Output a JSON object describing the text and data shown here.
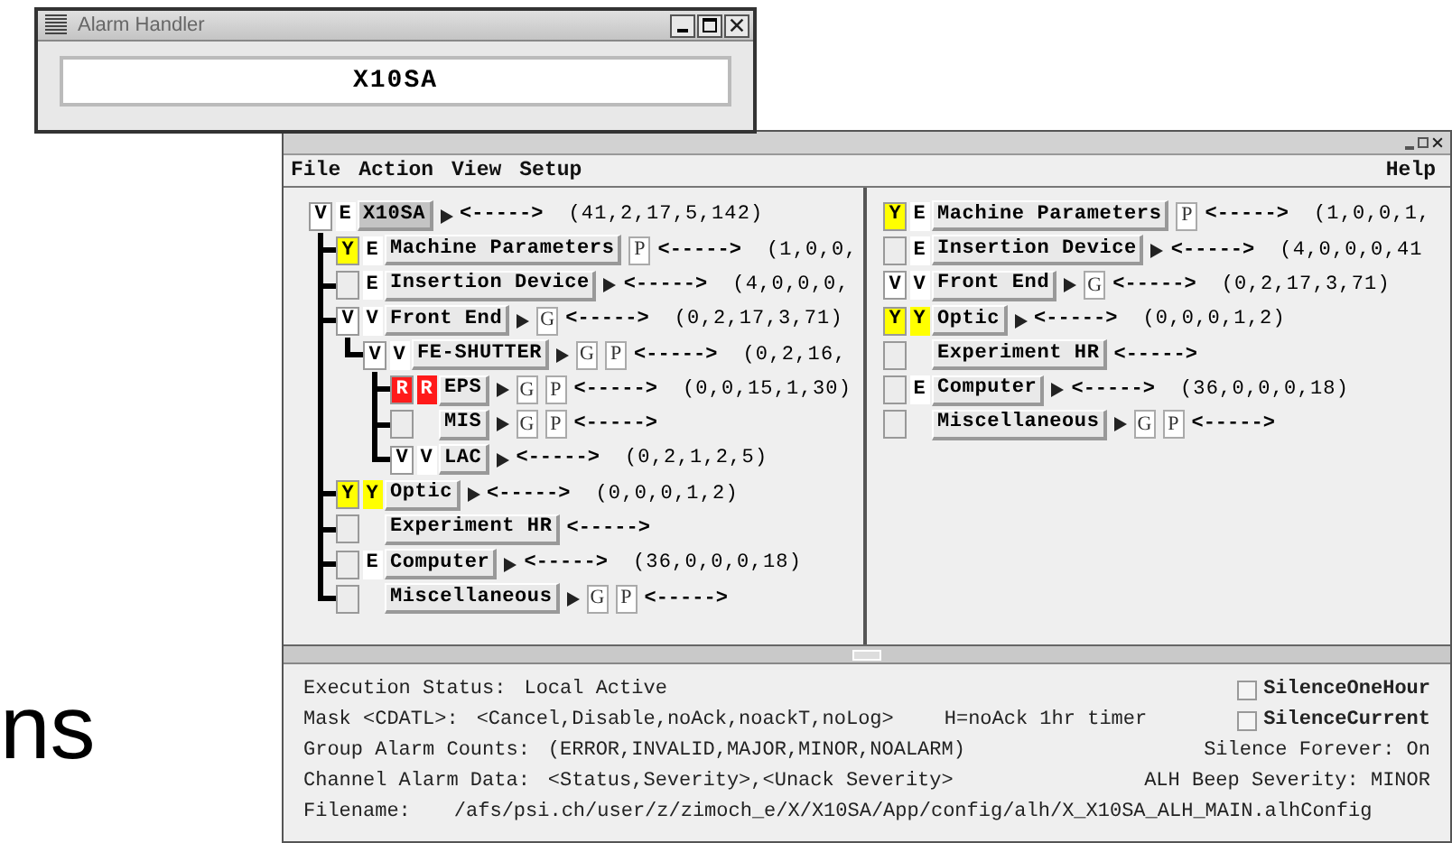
{
  "background_text": "ns",
  "popup_window": {
    "title": "Alarm Handler",
    "group": "X10SA"
  },
  "main_window": {
    "menus": [
      "File",
      "Action",
      "View",
      "Setup"
    ],
    "help_menu": "Help",
    "tree": [
      {
        "ack": {
          "text": "V",
          "color": "#ffffff"
        },
        "unack": {
          "text": "E",
          "color": "#ffffff"
        },
        "name": "X10SA",
        "selected": true,
        "has_arrow": true,
        "link": "<----->",
        "counts": "(41,2,17,5,142)",
        "children": [
          {
            "ack": {
              "text": "Y",
              "color": "#ffff00"
            },
            "unack": {
              "text": "E",
              "color": "#ffffff"
            },
            "name": "Machine Parameters",
            "selected": false,
            "has_arrow": false,
            "buttons": [
              "P"
            ],
            "link": "<----->",
            "counts": "(1,0,0,"
          },
          {
            "ack": {
              "color": "#ececec"
            },
            "unack": {
              "text": "E",
              "color": "#ffffff"
            },
            "name": "Insertion Device",
            "selected": false,
            "has_arrow": true,
            "link": "<----->",
            "counts": "(4,0,0,0,"
          },
          {
            "ack": {
              "text": "V",
              "color": "#ffffff"
            },
            "unack": {
              "text": "V",
              "color": "#ffffff"
            },
            "name": "Front End",
            "selected": false,
            "has_arrow": true,
            "buttons": [
              "G"
            ],
            "link": "<----->",
            "counts": "(0,2,17,3,71)",
            "children": [
              {
                "ack": {
                  "text": "V",
                  "color": "#ffffff"
                },
                "unack": {
                  "text": "V",
                  "color": "#ffffff"
                },
                "name": "FE-SHUTTER",
                "selected": false,
                "has_arrow": true,
                "buttons": [
                  "G",
                  "P"
                ],
                "link": "<----->",
                "counts": "(0,2,16,",
                "children": [
                  {
                    "ack": {
                      "text": "R",
                      "color": "#ff1a1a"
                    },
                    "unack": {
                      "text": "R",
                      "color": "#ff1a1a"
                    },
                    "name": "EPS",
                    "selected": false,
                    "has_arrow": true,
                    "buttons": [
                      "G",
                      "P"
                    ],
                    "link": "<----->",
                    "counts": "(0,0,15,1,30)"
                  },
                  {
                    "ack": {
                      "color": "#ececec"
                    },
                    "name": "MIS",
                    "selected": false,
                    "has_arrow": true,
                    "buttons": [
                      "G",
                      "P"
                    ],
                    "link": "<----->"
                  },
                  {
                    "ack": {
                      "text": "V",
                      "color": "#ffffff"
                    },
                    "unack": {
                      "text": "V",
                      "color": "#ffffff"
                    },
                    "name": "LAC",
                    "selected": false,
                    "has_arrow": true,
                    "link": "<----->",
                    "counts": "(0,2,1,2,5)"
                  }
                ]
              }
            ]
          },
          {
            "ack": {
              "text": "Y",
              "color": "#ffff00"
            },
            "unack": {
              "text": "Y",
              "color": "#ffff00"
            },
            "name": "Optic",
            "selected": false,
            "has_arrow": true,
            "link": "<----->",
            "counts": "(0,0,0,1,2)"
          },
          {
            "ack": {
              "color": "#ececec"
            },
            "name": "Experiment HR",
            "selected": false,
            "has_arrow": false,
            "link": "<----->"
          },
          {
            "ack": {
              "color": "#ececec"
            },
            "unack": {
              "text": "E",
              "color": "#ffffff"
            },
            "name": "Computer",
            "selected": false,
            "has_arrow": true,
            "link": "<----->",
            "counts": "(36,0,0,0,18)"
          },
          {
            "ack": {
              "color": "#ececec"
            },
            "name": "Miscellaneous",
            "selected": false,
            "has_arrow": true,
            "buttons": [
              "G",
              "P"
            ],
            "link": "<----->"
          }
        ]
      }
    ],
    "groups": [
      {
        "ack": {
          "text": "Y",
          "color": "#ffff00"
        },
        "unack": {
          "text": "E",
          "color": "#ffffff"
        },
        "name": "Machine Parameters",
        "selected": false,
        "has_arrow": false,
        "buttons": [
          "P"
        ],
        "link": "<----->",
        "counts": "(1,0,0,1,"
      },
      {
        "ack": {
          "color": "#ececec"
        },
        "unack": {
          "text": "E",
          "color": "#ffffff"
        },
        "name": "Insertion Device",
        "selected": false,
        "has_arrow": true,
        "link": "<----->",
        "counts": "(4,0,0,0,41"
      },
      {
        "ack": {
          "text": "V",
          "color": "#ffffff"
        },
        "unack": {
          "text": "V",
          "color": "#ffffff"
        },
        "name": "Front End",
        "selected": false,
        "has_arrow": true,
        "buttons": [
          "G"
        ],
        "link": "<----->",
        "counts": "(0,2,17,3,71)"
      },
      {
        "ack": {
          "text": "Y",
          "color": "#ffff00"
        },
        "unack": {
          "text": "Y",
          "color": "#ffff00"
        },
        "name": "Optic",
        "selected": false,
        "has_arrow": true,
        "link": "<----->",
        "counts": "(0,0,0,1,2)"
      },
      {
        "ack": {
          "color": "#ececec"
        },
        "name": "Experiment HR",
        "selected": false,
        "has_arrow": false,
        "link": "<----->"
      },
      {
        "ack": {
          "color": "#ececec"
        },
        "unack": {
          "text": "E",
          "color": "#ffffff"
        },
        "name": "Computer",
        "selected": false,
        "has_arrow": true,
        "link": "<----->",
        "counts": "(36,0,0,0,18)"
      },
      {
        "ack": {
          "color": "#ececec"
        },
        "name": "Miscellaneous",
        "selected": false,
        "has_arrow": true,
        "buttons": [
          "G",
          "P"
        ],
        "link": "<----->"
      }
    ],
    "status": {
      "lines": [
        {
          "label": "Execution Status:",
          "value": "Local Active"
        },
        {
          "label": "Mask <CDATL>:",
          "value": "<Cancel,Disable,noAck,noackT,noLog>"
        },
        {
          "label": "Group Alarm Counts:",
          "value": "(ERROR,INVALID,MAJOR,MINOR,NOALARM)"
        },
        {
          "label": "Channel Alarm Data:",
          "value": "<Status,Severity>,<Unack Severity>"
        }
      ],
      "mask_hint": "H=noAck 1hr timer",
      "options": [
        {
          "label": "SilenceOneHour",
          "checked": false
        },
        {
          "label": "SilenceCurrent",
          "checked": false
        }
      ],
      "silence_forever": "Silence Forever:  On",
      "beep_severity": "ALH Beep Severity: MINOR",
      "filename_label": "Filename:",
      "filename": "/afs/psi.ch/user/z/zimoch_e/X/X10SA/App/config/alh/X_X10SA_ALH_MAIN.alhConfig"
    }
  }
}
